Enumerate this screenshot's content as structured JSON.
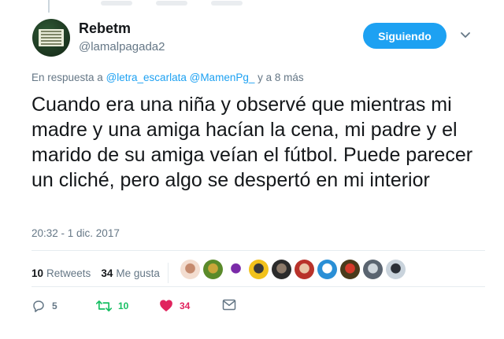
{
  "author": {
    "name": "Rebetm",
    "handle": "@lamalpagada2",
    "avatar_colors": [
      "#1e3a22",
      "#e9ecd9"
    ]
  },
  "follow_button": {
    "label": "Siguiendo",
    "color": "#1da1f2"
  },
  "reply_context": {
    "prefix": "En respuesta a",
    "mention_1": "@letra_escarlata",
    "mention_2": "@MamenPg_",
    "suffix": "y a 8 más"
  },
  "tweet": {
    "text": "Cuando era una niña y observé que mientras mi madre y una amiga hacían la cena, mi padre y el marido de su amiga veían el fútbol. Puede parecer un cliché, pero algo se despertó en mi interior",
    "timestamp": "20:32 - 1 dic. 2017"
  },
  "stats": {
    "retweets_count": "10",
    "retweets_label": "Retweets",
    "likes_count": "34",
    "likes_label": "Me gusta"
  },
  "likers": [
    {
      "icon": "avatar-woman",
      "colors": [
        "#f3ddd0",
        "#c58a6e"
      ]
    },
    {
      "icon": "avatar-apple",
      "colors": [
        "#5a8a2a",
        "#caa63a"
      ]
    },
    {
      "icon": "avatar-purple-pattern",
      "colors": [
        "#ffffff",
        "#7a2aa8"
      ]
    },
    {
      "icon": "avatar-yellow-cartoon",
      "colors": [
        "#f2c21b",
        "#3a3a3a"
      ]
    },
    {
      "icon": "avatar-dark-photo",
      "colors": [
        "#2b2b2b",
        "#8c7a6a"
      ]
    },
    {
      "icon": "avatar-red-hair",
      "colors": [
        "#b8322a",
        "#e9c6a8"
      ]
    },
    {
      "icon": "avatar-blue-fish",
      "colors": [
        "#2a8fd6",
        "#ffffff"
      ]
    },
    {
      "icon": "avatar-brown-red",
      "colors": [
        "#4a3a1a",
        "#d63a2a"
      ]
    },
    {
      "icon": "avatar-gray-photo",
      "colors": [
        "#5a6470",
        "#cfd6dc"
      ]
    },
    {
      "icon": "avatar-cat",
      "colors": [
        "#c9d3dc",
        "#2a2f36"
      ]
    }
  ],
  "actions": {
    "reply_count": "5",
    "retweet_count": "10",
    "like_count": "34",
    "reply_color": "#657786",
    "retweet_color": "#17bf63",
    "like_color": "#e0245e"
  }
}
